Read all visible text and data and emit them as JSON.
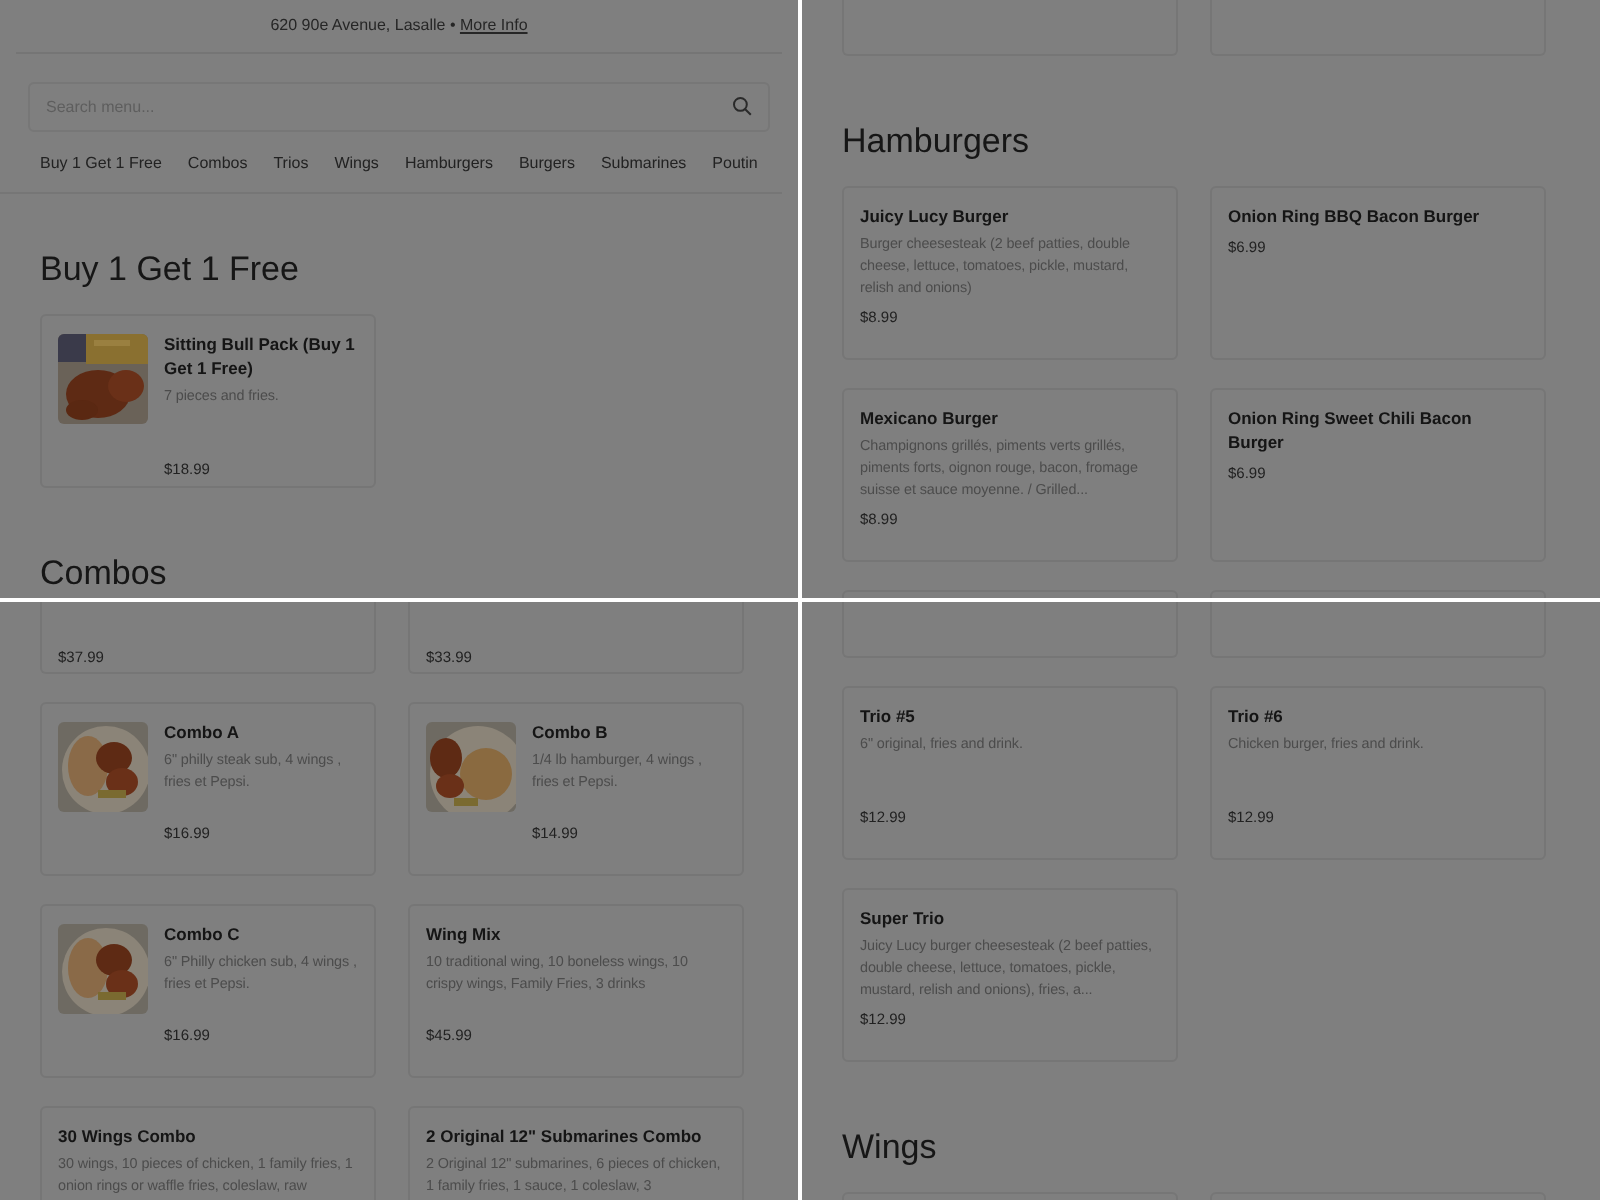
{
  "panels": [
    {
      "header": {
        "address": "620 90e Avenue, Lasalle •",
        "link": "More Info"
      },
      "search": {
        "placeholder": "Search menu..."
      },
      "categories": [
        "Buy 1 Get 1 Free",
        "Combos",
        "Trios",
        "Wings",
        "Hamburgers",
        "Burgers",
        "Submarines",
        "Poutin"
      ],
      "blocks": [
        {
          "kind": "heading",
          "text": "Buy 1 Get 1 Free"
        },
        {
          "kind": "cards",
          "items": [
            {
              "kind": "picture",
              "name": "Sitting Bull Pack (Buy 1 Get 1 Free)",
              "description": "7 pieces and fries.",
              "price": "$18.99"
            }
          ]
        },
        {
          "kind": "heading",
          "text": "Combos"
        }
      ]
    },
    {
      "blocks": [
        {
          "kind": "cards",
          "items": [
            {
              "kind": "stub",
              "price": "$37.99"
            },
            {
              "kind": "stub",
              "price": "$33.99"
            }
          ]
        },
        {
          "kind": "cards",
          "items": [
            {
              "kind": "picture",
              "name": "Combo A",
              "description": "6\" philly steak sub, 4 wings , fries et Pepsi.",
              "price": "$16.99"
            },
            {
              "kind": "picture",
              "name": "Combo B",
              "description": "1/4 lb hamburger, 4 wings , fries et Pepsi.",
              "price": "$14.99"
            }
          ]
        },
        {
          "kind": "cards",
          "items": [
            {
              "kind": "picture",
              "name": "Combo C",
              "description": "6\" Philly chicken sub, 4 wings , fries et Pepsi.",
              "price": "$16.99"
            },
            {
              "kind": "plain",
              "name": "Wing Mix",
              "description": "10 traditional wing, 10 boneless wings, 10 crispy wings, Family Fries, 3 drinks",
              "price": "$45.99"
            }
          ]
        },
        {
          "kind": "cards",
          "items": [
            {
              "kind": "plain",
              "name": "30 Wings Combo",
              "description": "30 wings, 10 pieces of chicken, 1 family fries, 1 onion rings or waffle fries, coleslaw, raw"
            },
            {
              "kind": "plain",
              "name": "2 Original 12\" Submarines Combo",
              "description": "2 Original 12\" submarines, 6 pieces of chicken, 1 family fries, 1 sauce, 1 coleslaw, 3"
            }
          ]
        }
      ]
    },
    {
      "blocks": [
        {
          "kind": "cards",
          "items": [
            {
              "kind": "stub"
            },
            {
              "kind": "stub"
            }
          ]
        },
        {
          "kind": "heading",
          "text": "Hamburgers"
        },
        {
          "kind": "cards",
          "items": [
            {
              "kind": "plain",
              "name": "Juicy Lucy Burger",
              "description": "Burger cheesesteak (2 beef patties, double cheese, lettuce, tomatoes, pickle, mustard, relish and onions)",
              "price": "$8.99"
            },
            {
              "kind": "plain",
              "name": "Onion Ring BBQ Bacon Burger",
              "price": "$6.99"
            }
          ]
        },
        {
          "kind": "cards",
          "items": [
            {
              "kind": "plain",
              "name": "Mexicano Burger",
              "description": "Champignons grillés, piments verts grillés, piments forts, oignon rouge, bacon, fromage suisse et sauce moyenne. / Grilled...",
              "price": "$8.99"
            },
            {
              "kind": "plain",
              "name": "Onion Ring Sweet Chili Bacon Burger",
              "price": "$6.99"
            }
          ]
        },
        {
          "kind": "cards",
          "items": [
            {
              "kind": "plain"
            },
            {
              "kind": "plain"
            }
          ]
        }
      ]
    },
    {
      "blocks": [
        {
          "kind": "cards",
          "items": [
            {
              "kind": "stub"
            },
            {
              "kind": "stub"
            }
          ]
        },
        {
          "kind": "cards",
          "items": [
            {
              "kind": "plain",
              "name": "Trio #5",
              "description": "6\" original, fries and drink.",
              "price": "$12.99"
            },
            {
              "kind": "plain",
              "name": "Trio #6",
              "description": "Chicken burger, fries and drink.",
              "price": "$12.99"
            }
          ]
        },
        {
          "kind": "cards",
          "items": [
            {
              "kind": "plain",
              "name": "Super Trio",
              "description": "Juicy Lucy burger cheesesteak (2 beef patties, double cheese, lettuce, tomatoes, pickle, mustard, relish and onions), fries, a...",
              "price": "$12.99"
            }
          ]
        },
        {
          "kind": "heading",
          "text": "Wings"
        },
        {
          "kind": "cards",
          "items": [
            {
              "kind": "plain"
            },
            {
              "kind": "plain"
            }
          ]
        }
      ]
    }
  ]
}
